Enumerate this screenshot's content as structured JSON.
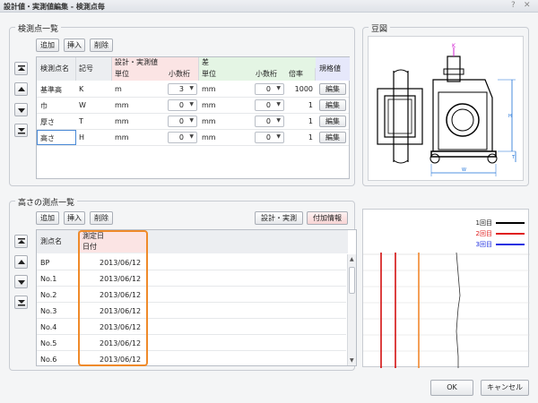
{
  "window": {
    "title": "設計値・実測値編集 - 検測点毎",
    "help_icon": "?",
    "close_icon": "✕"
  },
  "top_group": {
    "title": "検測点一覧",
    "buttons": {
      "add": "追加",
      "insert": "挿入",
      "delete": "削除"
    },
    "headers": {
      "point_name": "検測点名",
      "symbol": "記号",
      "design_measured": "設計・実測値",
      "unit": "単位",
      "decimals": "小数桁",
      "difference": "差",
      "diff_unit": "単位",
      "diff_decimals": "小数桁",
      "magnification": "倍率",
      "standard": "規格値"
    },
    "rows": [
      {
        "name": "基準高",
        "symbol": "K",
        "unit": "m",
        "decimals": "3",
        "diff_unit": "mm",
        "diff_decimals": "0",
        "mag": "1000",
        "edit": "編集"
      },
      {
        "name": "巾",
        "symbol": "W",
        "unit": "mm",
        "decimals": "0",
        "diff_unit": "mm",
        "diff_decimals": "0",
        "mag": "1",
        "edit": "編集"
      },
      {
        "name": "厚さ",
        "symbol": "T",
        "unit": "mm",
        "decimals": "0",
        "diff_unit": "mm",
        "diff_decimals": "0",
        "mag": "1",
        "edit": "編集"
      },
      {
        "name": "高さ",
        "symbol": "H",
        "unit": "mm",
        "decimals": "0",
        "diff_unit": "mm",
        "diff_decimals": "0",
        "mag": "1",
        "edit": "編集"
      }
    ]
  },
  "diagram": {
    "title": "豆図",
    "labels": {
      "k": "K",
      "h": "H",
      "t": "T",
      "w": "W"
    }
  },
  "bottom_group": {
    "title": "高さの測点一覧",
    "buttons": {
      "add": "追加",
      "insert": "挿入",
      "delete": "削除",
      "design_measured": "設計・実測",
      "extra_info": "付加情報"
    },
    "headers": {
      "point_name": "測点名",
      "measure_date": "測定日",
      "date": "日付"
    },
    "rows": [
      {
        "name": "BP",
        "date": "2013/06/12"
      },
      {
        "name": "No.1",
        "date": "2013/06/12"
      },
      {
        "name": "No.2",
        "date": "2013/06/12"
      },
      {
        "name": "No.3",
        "date": "2013/06/12"
      },
      {
        "name": "No.4",
        "date": "2013/06/12"
      },
      {
        "name": "No.5",
        "date": "2013/06/12"
      },
      {
        "name": "No.6",
        "date": "2013/06/12"
      }
    ]
  },
  "legend": [
    {
      "label": "1回目",
      "color": "#000000"
    },
    {
      "label": "2回目",
      "color": "#e02020"
    },
    {
      "label": "3回目",
      "color": "#2030e0"
    }
  ],
  "footer": {
    "ok": "OK",
    "cancel": "キャンセル"
  }
}
